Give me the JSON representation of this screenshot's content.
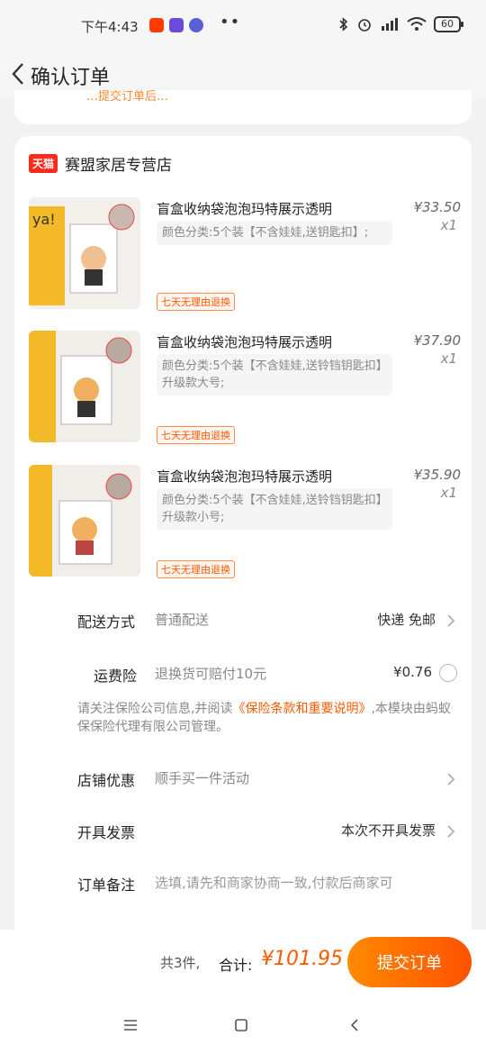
{
  "status_bar": {
    "time": "下午4:43",
    "battery": "60",
    "more": "••",
    "app_icon_colors": [
      "#ff3d00",
      "#6c4bd8",
      "#5a5fd8"
    ]
  },
  "header": {
    "title": "确认订单",
    "back_icon": "chevron-left-icon"
  },
  "top_card": {
    "partial_text": "…提交订单后…"
  },
  "shop": {
    "badge": "天猫",
    "name": "赛盟家居专营店"
  },
  "products": [
    {
      "title": "盲盒收纳袋泡泡玛特展示透明",
      "spec": "颜色分类:5个装【不含娃娃,送钥匙扣】;",
      "tag": "七天无理由退换",
      "price": "¥33.50",
      "qty": "x1"
    },
    {
      "title": "盲盒收纳袋泡泡玛特展示透明",
      "spec": "颜色分类:5个装【不含娃娃,送铃铛钥匙扣】升级款大号;",
      "tag": "七天无理由退换",
      "price": "¥37.90",
      "qty": "x1"
    },
    {
      "title": "盲盒收纳袋泡泡玛特展示透明",
      "spec": "颜色分类:5个装【不含娃娃,送铃铛钥匙扣】升级款小号;",
      "tag": "七天无理由退换",
      "price": "¥35.90",
      "qty": "x1"
    }
  ],
  "delivery": {
    "label": "配送方式",
    "value": "普通配送",
    "right": "快递 免邮"
  },
  "insurance": {
    "label": "运费险",
    "value": "退换货可赔付10元",
    "price": "¥0.76",
    "note_prefix": "请关注保险公司信息,并阅读",
    "note_link": "《保险条款和重要说明》",
    "note_suffix": ",本模块由蚂蚁保保险代理有限公司管理。"
  },
  "shop_discount": {
    "label": "店铺优惠",
    "value": "顺手买一件活动"
  },
  "invoice": {
    "label": "开具发票",
    "right": "本次不开具发票"
  },
  "remark": {
    "label": "订单备注",
    "placeholder": "选填,请先和商家协商一致,付款后商家可"
  },
  "bottom": {
    "count": "共3件,",
    "total_label": "合计:",
    "total": "¥101.95",
    "submit": "提交订单"
  },
  "colors": {
    "accent": "#ff5a00",
    "tmall": "#ff2a1a"
  }
}
